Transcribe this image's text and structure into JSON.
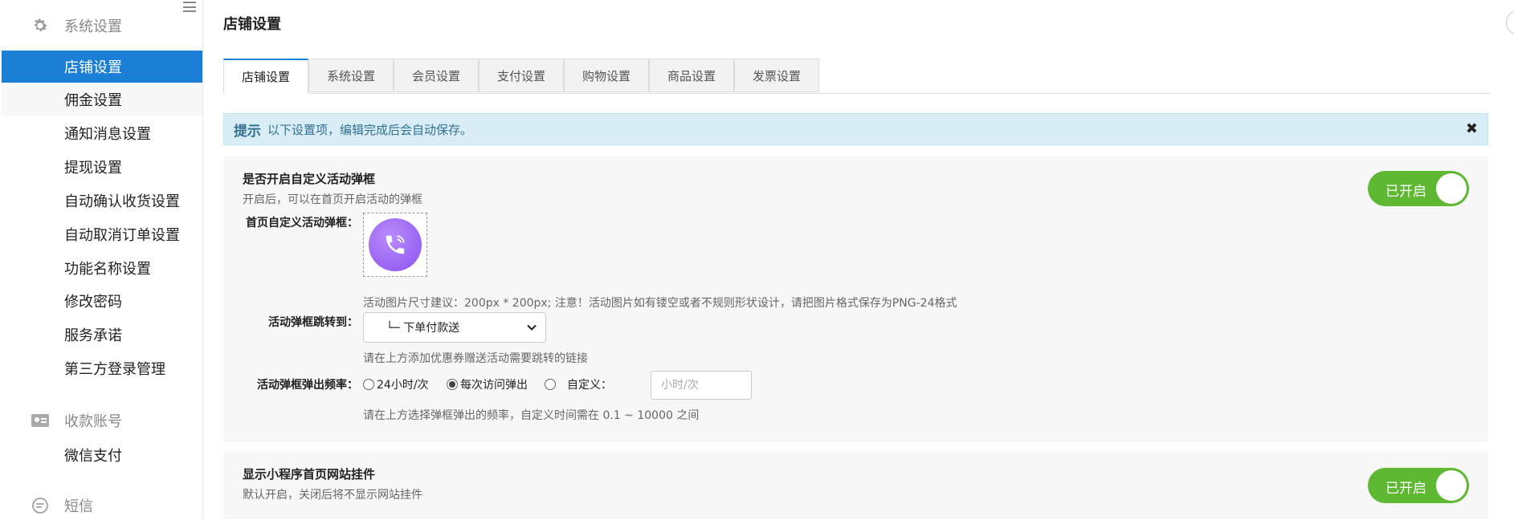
{
  "sidebar": {
    "group1": {
      "icon": "gear-icon",
      "label": "系统设置"
    },
    "items1": [
      {
        "label": "店铺设置",
        "active": true
      },
      {
        "label": "佣金设置"
      },
      {
        "label": "通知消息设置"
      },
      {
        "label": "提现设置"
      },
      {
        "label": "自动确认收货设置"
      },
      {
        "label": "自动取消订单设置"
      },
      {
        "label": "功能名称设置"
      },
      {
        "label": "修改密码"
      },
      {
        "label": "服务承诺"
      },
      {
        "label": "第三方登录管理"
      }
    ],
    "group2": {
      "icon": "id-card-icon",
      "label": "收款账号"
    },
    "items2": [
      {
        "label": "微信支付"
      }
    ],
    "group3": {
      "icon": "message-icon",
      "label": "短信"
    }
  },
  "page": {
    "title": "店铺设置"
  },
  "tabs": [
    "店铺设置",
    "系统设置",
    "会员设置",
    "支付设置",
    "购物设置",
    "商品设置",
    "发票设置"
  ],
  "notice": {
    "title": "提示",
    "text": "以下设置项，编辑完成后会自动保存。"
  },
  "section1": {
    "title": "是否开启自定义活动弹框",
    "desc": "开启后，可以在首页开启活动的弹框",
    "toggle_label": "已开启",
    "image_label": "首页自定义活动弹框：",
    "image_icon": "phone-icon",
    "image_hint": "活动图片尺寸建议：200px * 200px; 注意！活动图片如有镂空或者不规则形状设计，请把图片格式保存为PNG-24格式",
    "jump_label": "活动弹框跳转到：",
    "jump_value": "└─ 下单付款送",
    "jump_hint": "请在上方添加优惠券赠送活动需要跳转的链接",
    "freq_label": "活动弹框弹出频率：",
    "freq_options": [
      "24小时/次",
      "每次访问弹出",
      "自定义："
    ],
    "freq_selected": 1,
    "custom_placeholder": "小时/次",
    "freq_hint": "请在上方选择弹框弹出的频率，自定义时间需在 0.1 ~ 10000 之间"
  },
  "section2": {
    "title": "显示小程序首页网站挂件",
    "desc": "默认开启，关闭后将不显示网站挂件",
    "toggle_label": "已开启"
  },
  "colors": {
    "primary": "#1b7fd6",
    "toggle_on": "#5fb831",
    "notice_bg": "#d9edf7"
  }
}
